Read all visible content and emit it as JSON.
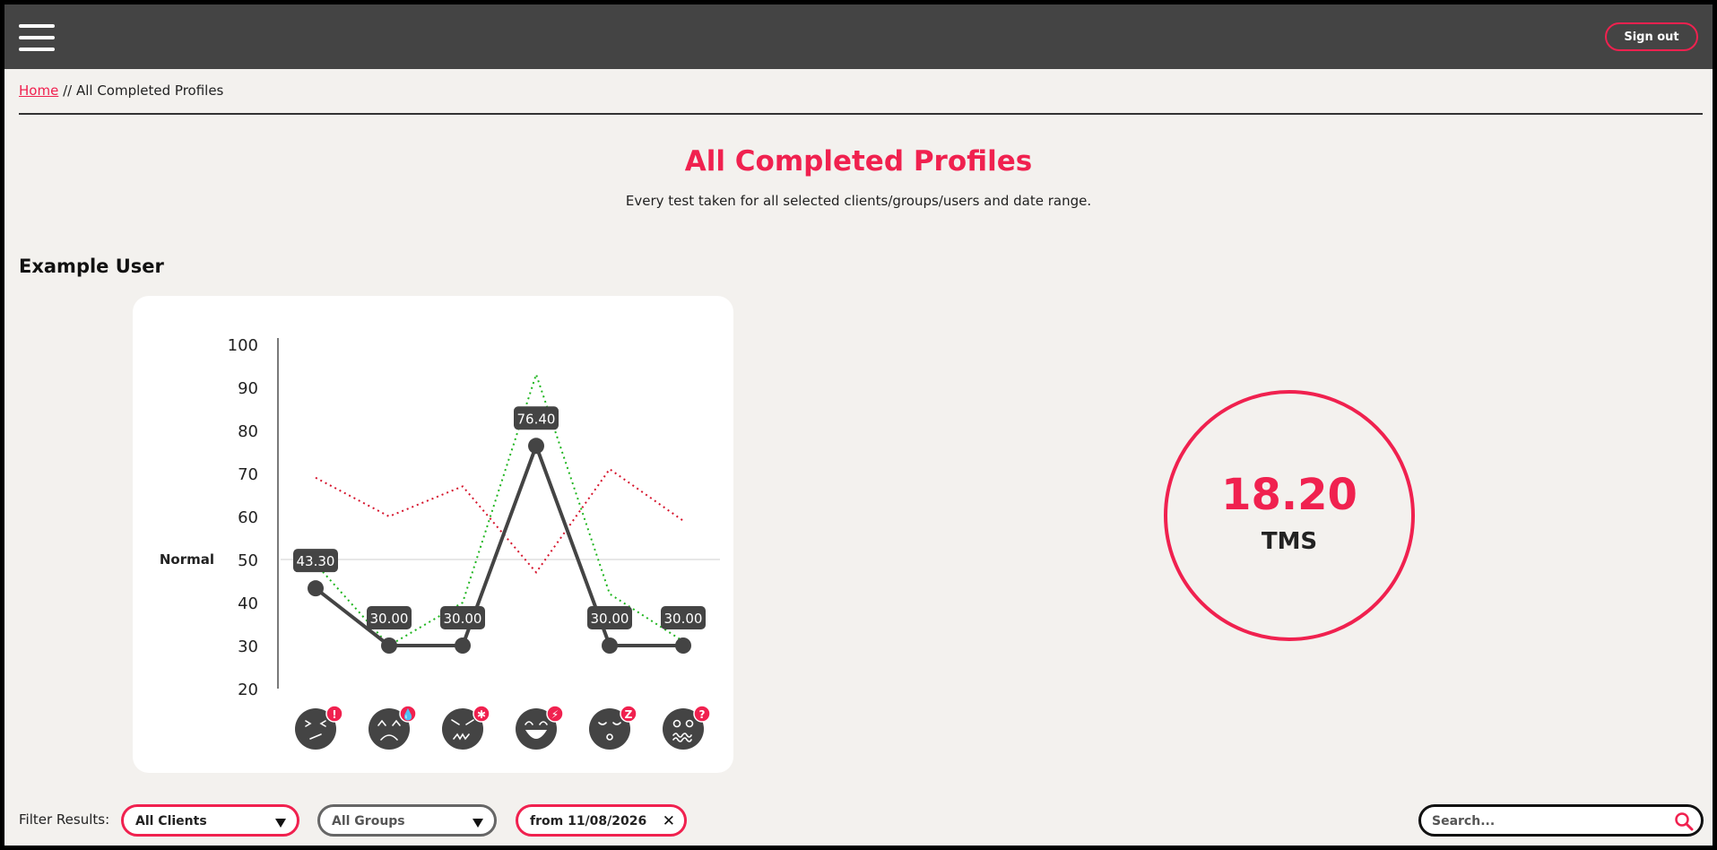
{
  "header": {
    "signout_label": "Sign out"
  },
  "breadcrumb": {
    "home": "Home",
    "separator": "//",
    "current": "All Completed Profiles"
  },
  "page": {
    "title": "All Completed Profiles",
    "subtitle": "Every test taken for all selected clients/groups/users and date range."
  },
  "user": {
    "name": "Example User"
  },
  "tms": {
    "value": "18.20",
    "label": "TMS"
  },
  "filters": {
    "label": "Filter Results:",
    "clients": "All Clients",
    "groups": "All Groups",
    "date": "from 11/08/2026",
    "search_placeholder": "Search..."
  },
  "colors": {
    "accent": "#f0214f",
    "dark": "#444444",
    "green": "#1fb51f",
    "red": "#d6152d"
  },
  "chart_data": {
    "type": "line",
    "ylim": [
      20,
      100
    ],
    "yticks": [
      100,
      90,
      80,
      70,
      60,
      50,
      40,
      30,
      20
    ],
    "reference": {
      "label": "Normal",
      "value": 50
    },
    "categories": [
      "stress-face-icon",
      "sad-face-icon",
      "angry-face-icon",
      "happy-face-icon",
      "tired-face-icon",
      "confused-face-icon"
    ],
    "series": [
      {
        "values": [
          43.3,
          30.0,
          30.0,
          76.4,
          30.0,
          30.0
        ],
        "labels": [
          "43.30",
          "30.00",
          "30.00",
          "76.40",
          "30.00",
          "30.00"
        ],
        "color": "#444444",
        "style": "solid"
      },
      {
        "values": [
          49,
          30,
          40,
          93,
          42,
          31
        ],
        "color": "#1fb51f",
        "style": "dotted"
      },
      {
        "values": [
          69,
          60,
          67,
          47,
          71,
          59
        ],
        "color": "#d6152d",
        "style": "dotted"
      }
    ],
    "badges": [
      "!",
      "💧",
      "✱",
      "⚡",
      "Z",
      "?"
    ]
  }
}
